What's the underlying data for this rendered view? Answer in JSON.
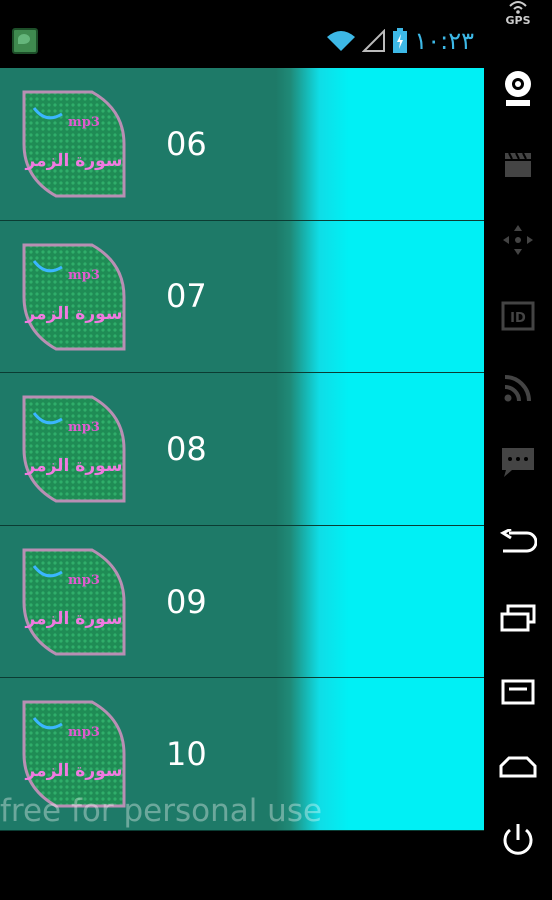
{
  "status_bar": {
    "time": "١٠:٢٣",
    "gps_label": "GPS"
  },
  "list": {
    "items": [
      {
        "label": "06",
        "thumb_title": "سورة الزمر",
        "thumb_tag": "mp3"
      },
      {
        "label": "07",
        "thumb_title": "سورة الزمر",
        "thumb_tag": "mp3"
      },
      {
        "label": "08",
        "thumb_title": "سورة الزمر",
        "thumb_tag": "mp3"
      },
      {
        "label": "09",
        "thumb_title": "سورة الزمر",
        "thumb_tag": "mp3"
      },
      {
        "label": "10",
        "thumb_title": "سورة الزمر",
        "thumb_tag": "mp3"
      }
    ]
  },
  "watermark": "free for personal use",
  "nav_icons": [
    "webcam-icon",
    "clapper-icon",
    "dpad-icon",
    "id-icon",
    "rss-icon",
    "message-icon",
    "back-icon",
    "recent-apps-icon",
    "menu-icon",
    "home-icon",
    "power-icon"
  ],
  "colors": {
    "list_bg": "#1e7a68",
    "accent_cyan": "#00f0f5",
    "time": "#3db8e6"
  }
}
